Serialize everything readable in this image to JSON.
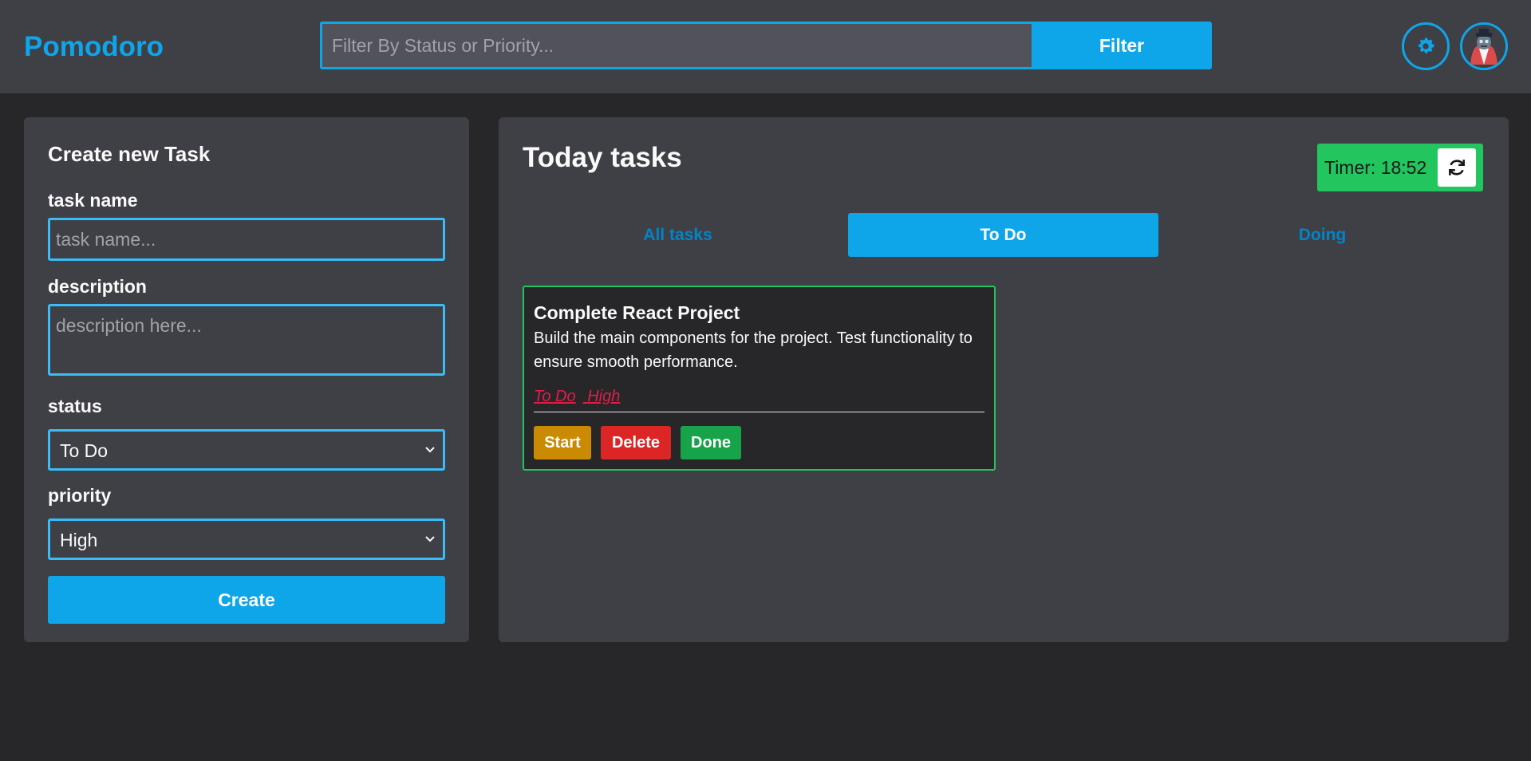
{
  "header": {
    "brand": "Pomodoro",
    "search": {
      "placeholder": "Filter By Status or Priority...",
      "value": ""
    },
    "filter_label": "Filter"
  },
  "create_panel": {
    "title": "Create new Task",
    "task_name": {
      "label": "task name",
      "placeholder": "task name...",
      "value": ""
    },
    "description": {
      "label": "description",
      "placeholder": "description here...",
      "value": ""
    },
    "status": {
      "label": "status",
      "selected": "To Do"
    },
    "priority": {
      "label": "priority",
      "selected": "High"
    },
    "create_label": "Create"
  },
  "tasks_panel": {
    "title": "Today tasks",
    "timer_text": "Timer: 18:52",
    "tabs": [
      {
        "label": "All tasks",
        "active": false
      },
      {
        "label": "To Do",
        "active": true
      },
      {
        "label": "Doing",
        "active": false
      }
    ],
    "tasks": [
      {
        "title": "Complete React Project",
        "description": "Build the main components for the project. Test functionality to ensure smooth performance.",
        "status": "To Do",
        "priority": "High",
        "start_label": "Start",
        "delete_label": "Delete",
        "done_label": "Done"
      }
    ]
  },
  "icons": {
    "settings": "gear-icon",
    "avatar": "avatar",
    "timer_reset": "refresh-icon",
    "chevron": "chevron-down-icon"
  },
  "colors": {
    "accent": "#0ea5e9",
    "background": "#27272a",
    "panel": "#3f3f46",
    "timer": "#22c55e",
    "start": "#ca8a04",
    "delete": "#dc2626",
    "done": "#16a34a",
    "tag": "#e11d48"
  }
}
